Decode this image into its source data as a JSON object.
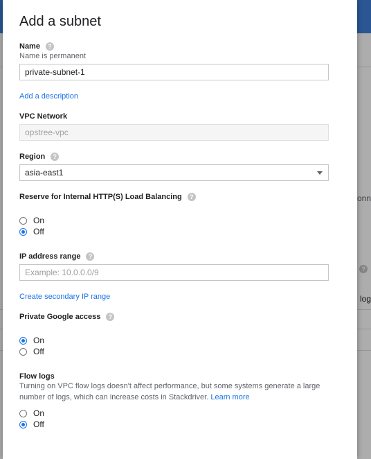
{
  "background": {
    "right_snippets": [
      "onne",
      "logs"
    ],
    "help_glyph": "?"
  },
  "dialog": {
    "title": "Add a subnet",
    "name": {
      "label": "Name",
      "hint": "Name is permanent",
      "value": "private-subnet-1"
    },
    "add_description_link": "Add a description",
    "vpc_network": {
      "label": "VPC Network",
      "value": "opstree-vpc"
    },
    "region": {
      "label": "Region",
      "selected": "asia-east1"
    },
    "reserve_lb": {
      "label": "Reserve for Internal HTTP(S) Load Balancing",
      "options": [
        "On",
        "Off"
      ],
      "selected": "Off"
    },
    "ip_range": {
      "label": "IP address range",
      "placeholder": "Example: 10.0.0.0/9"
    },
    "secondary_ip_link": "Create secondary IP range",
    "private_google_access": {
      "label": "Private Google access",
      "options": [
        "On",
        "Off"
      ],
      "selected": "On"
    },
    "flow_logs": {
      "label": "Flow logs",
      "description": "Turning on VPC flow logs doesn't affect performance, but some systems generate a large number of logs, which can increase costs in Stackdriver.",
      "learn_more": "Learn more",
      "options": [
        "On",
        "Off"
      ],
      "selected": "Off"
    }
  },
  "colors": {
    "accent": "#1a73e8",
    "topbar": "#3f7fd9"
  }
}
